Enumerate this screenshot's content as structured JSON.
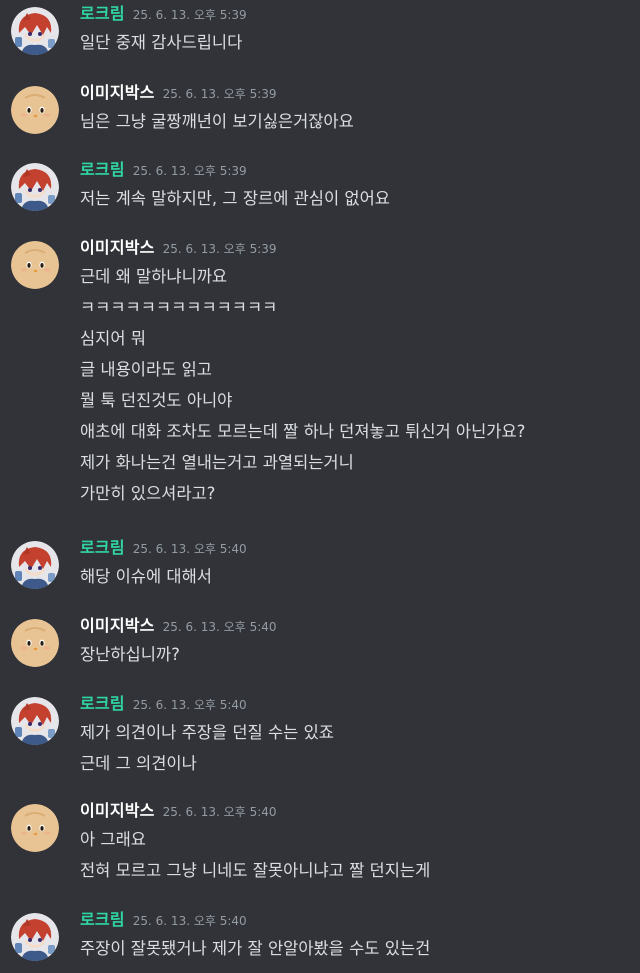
{
  "users": {
    "rokrim": {
      "name": "로크림",
      "color": "#2fd6a3",
      "avatar_icon": "red-haired-anime-avatar-icon"
    },
    "imiji": {
      "name": "이미지박스",
      "color": "#ffffff",
      "avatar_icon": "smiling-face-avatar-icon"
    }
  },
  "messages": [
    {
      "user": "rokrim",
      "timestamp": "25. 6. 13. 오후 5:39",
      "lines": [
        "일단 중재 감사드립니다"
      ]
    },
    {
      "user": "imiji",
      "timestamp": "25. 6. 13. 오후 5:39",
      "lines": [
        "님은 그냥 굴짱깨년이 보기싫은거잖아요"
      ]
    },
    {
      "user": "rokrim",
      "timestamp": "25. 6. 13. 오후 5:39",
      "lines": [
        "저는 계속 말하지만, 그 장르에 관심이 없어요"
      ]
    },
    {
      "user": "imiji",
      "timestamp": "25. 6. 13. 오후 5:39",
      "lines": [
        "근데 왜 말하냐니까요",
        "ㅋㅋㅋㅋㅋㅋㅋㅋㅋㅋㅋㅋㅋ",
        "심지어 뭐",
        "글 내용이라도 읽고",
        "뭘 툭 던진것도 아니야",
        "애초에 대화 조차도 모르는데 짤 하나 던져놓고 튀신거 아닌가요?",
        "제가 화나는건 열내는거고 과열되는거니",
        "가만히 있으셔라고?"
      ]
    },
    {
      "user": "rokrim",
      "timestamp": "25. 6. 13. 오후 5:40",
      "lines": [
        "해당 이슈에 대해서"
      ]
    },
    {
      "user": "imiji",
      "timestamp": "25. 6. 13. 오후 5:40",
      "lines": [
        "장난하십니까?"
      ]
    },
    {
      "user": "rokrim",
      "timestamp": "25. 6. 13. 오후 5:40",
      "lines": [
        "제가 의견이나 주장을 던질 수는 있죠",
        "근데 그 의견이나"
      ]
    },
    {
      "user": "imiji",
      "timestamp": "25. 6. 13. 오후 5:40",
      "lines": [
        "아 그래요",
        "전혀 모르고 그냥 니네도 잘못아니냐고 짤 던지는게"
      ]
    },
    {
      "user": "rokrim",
      "timestamp": "25. 6. 13. 오후 5:40",
      "lines": [
        "주장이 잘못됐거나 제가 잘 안알아봤을 수도 있는건"
      ]
    }
  ]
}
